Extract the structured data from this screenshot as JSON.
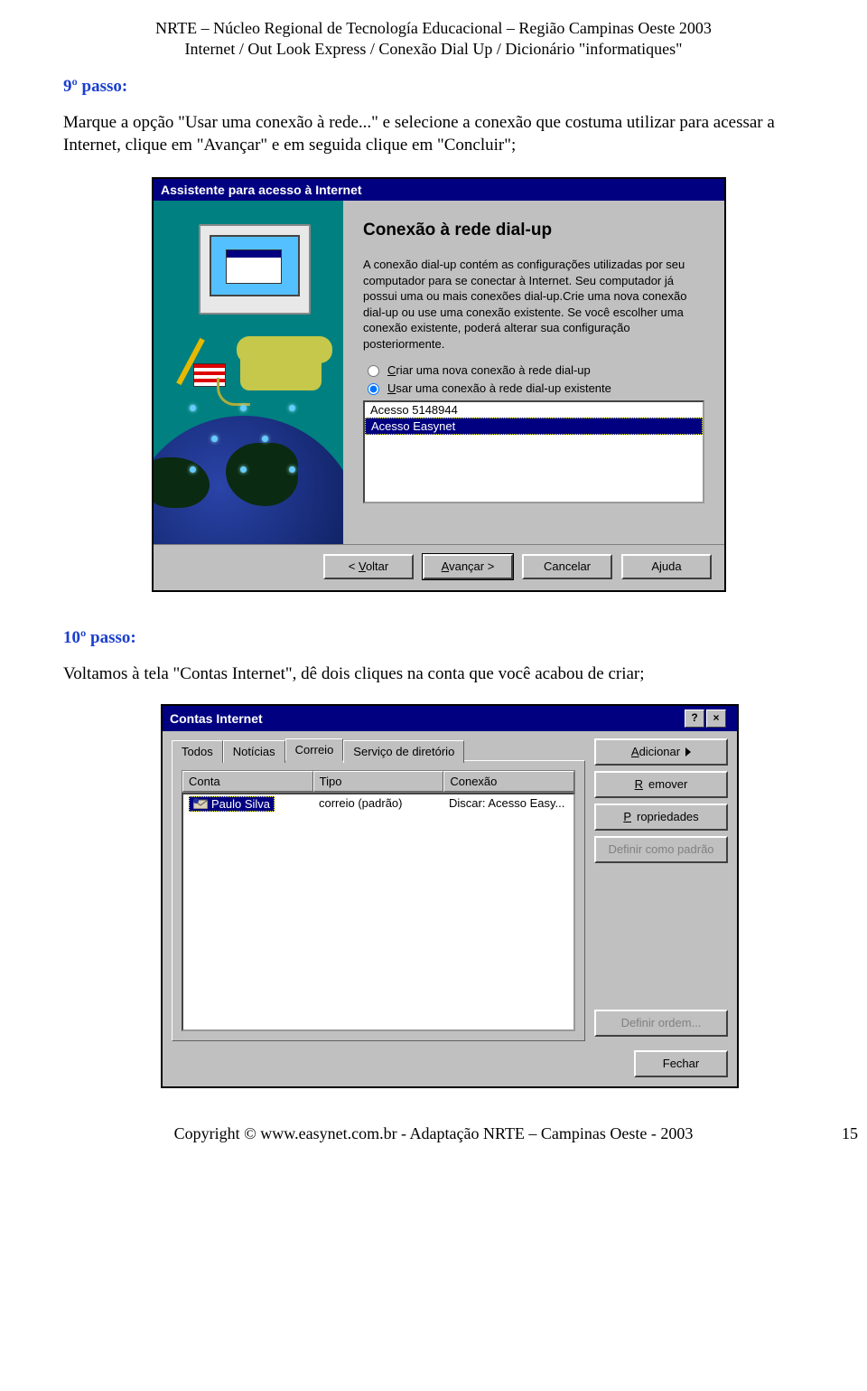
{
  "header": {
    "line1": "NRTE – Núcleo Regional de Tecnología Educacional – Região Campinas Oeste 2003",
    "line2": "Internet / Out Look Express / Conexão Dial Up / Dicionário \"informatiques\""
  },
  "step9": {
    "heading": "9º passo:",
    "text": "Marque a opção \"Usar uma conexão à rede...\" e selecione a conexão que costuma utilizar para acessar a Internet, clique em \"Avançar\" e em seguida clique em \"Concluir\";"
  },
  "wizard": {
    "titlebar": "Assistente para acesso à Internet",
    "heading": "Conexão à rede dial-up",
    "paragraph": "A conexão dial-up contém as configurações utilizadas por seu computador para se conectar à Internet. Seu computador já possui uma ou mais conexões dial-up.Crie uma nova conexão dial-up ou use uma conexão existente. Se você escolher uma conexão existente, poderá alterar sua configuração posteriormente.",
    "radio_new_pre": "C",
    "radio_new_rest": "riar uma nova conexão à rede dial-up",
    "radio_use_pre": "U",
    "radio_use_rest": "sar uma conexão à rede dial-up existente",
    "list": {
      "item1": "Acesso 5148944",
      "item2": "Acesso Easynet"
    },
    "buttons": {
      "back_u": "V",
      "back_rest": "oltar",
      "next_u": "A",
      "next_rest": "vançar >",
      "cancel": "Cancelar",
      "help": "Ajuda"
    }
  },
  "step10": {
    "heading": "10º passo:",
    "text": "Voltamos à tela \"Contas Internet\", dê dois cliques na conta que você acabou de criar;"
  },
  "accounts": {
    "titlebar": "Contas Internet",
    "help_icon": "?",
    "close_icon": "×",
    "tabs": {
      "todos": "Todos",
      "noticias": "Notícias",
      "correio": "Correio",
      "servico": "Serviço de diretório"
    },
    "columns": {
      "conta": "Conta",
      "tipo": "Tipo",
      "conexao": "Conexão"
    },
    "row": {
      "conta": "Paulo Silva",
      "tipo": "correio (padrão)",
      "conexao": "Discar: Acesso Easy..."
    },
    "buttons": {
      "adicionar_u": "A",
      "adicionar_rest": "dicionar",
      "remover_u": "R",
      "remover_rest": "emover",
      "prop_u": "P",
      "prop_rest": "ropriedades",
      "definir_padrao": "Definir como padrão",
      "definir_ordem": "Definir ordem...",
      "fechar": "Fechar"
    }
  },
  "footer": {
    "text": "Copyright © www.easynet.com.br - Adaptação NRTE – Campinas Oeste - 2003",
    "pagenum": "15"
  }
}
